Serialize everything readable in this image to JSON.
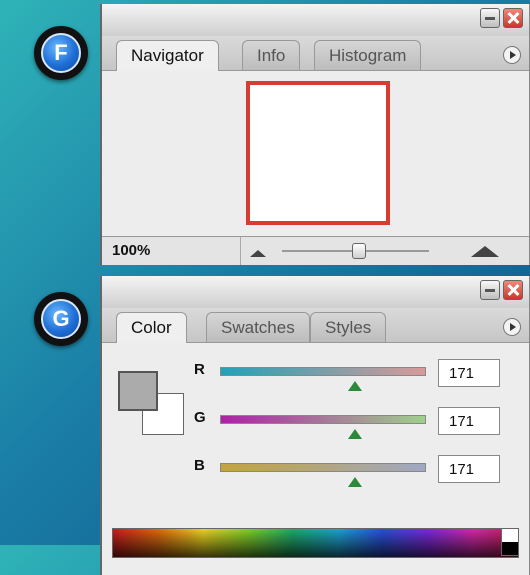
{
  "badges": {
    "first": "F",
    "second": "G"
  },
  "navigator_panel": {
    "tabs": [
      "Navigator",
      "Info",
      "Histogram"
    ],
    "zoom": "100%"
  },
  "color_panel": {
    "tabs": [
      "Color",
      "Swatches",
      "Styles"
    ],
    "channels": [
      {
        "label": "R",
        "value": "171"
      },
      {
        "label": "G",
        "value": "171"
      },
      {
        "label": "B",
        "value": "171"
      }
    ],
    "foreground_color": "#ababab",
    "background_color": "#ffffff"
  },
  "colors": {
    "preview_border": "#d63c32",
    "slider_arrow": "#2a8a3a"
  },
  "icons": [
    "minimize-icon",
    "close-icon",
    "panel-menu-icon",
    "zoom-out-icon",
    "zoom-in-icon"
  ]
}
